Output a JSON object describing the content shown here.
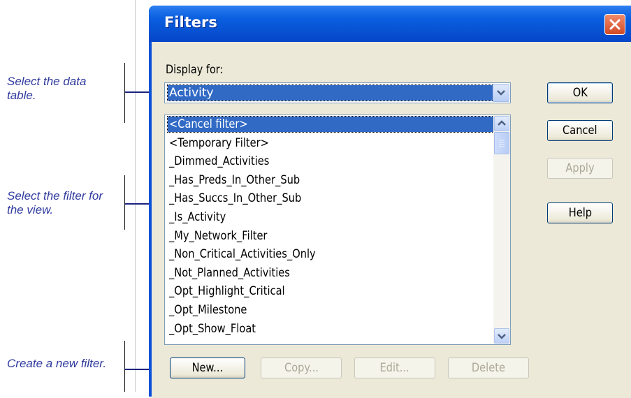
{
  "annotations": {
    "select_table": "Select the data table.",
    "select_filter": "Select the filter for the view.",
    "create_filter": "Create a new filter."
  },
  "dialog": {
    "title": "Filters",
    "display_for_label": "Display for:",
    "display_for_value": "Activity",
    "filters": [
      "<Cancel filter>",
      "<Temporary Filter>",
      "_Dimmed_Activities",
      "_Has_Preds_In_Other_Sub",
      "_Has_Succs_In_Other_Sub",
      "_Is_Activity",
      "_My_Network_Filter",
      "_Non_Critical_Activities_Only",
      "_Not_Planned_Activities",
      "_Opt_Highlight_Critical",
      "_Opt_Milestone",
      "_Opt_Show_Float"
    ],
    "selected_filter_index": 0,
    "buttons": {
      "ok": "OK",
      "cancel": "Cancel",
      "apply": "Apply",
      "help": "Help",
      "new": "New...",
      "copy": "Copy...",
      "edit": "Edit...",
      "delete": "Delete"
    }
  },
  "icons": {
    "close": "close-icon",
    "dropdown": "chevron-down-icon",
    "scroll_up": "chevron-up-icon",
    "scroll_down": "chevron-down-icon"
  },
  "colors": {
    "titlebar": "#0a5fe0",
    "selection": "#316ac5",
    "annotation": "#2f3a9e",
    "dialog_face": "#ece9d8"
  }
}
